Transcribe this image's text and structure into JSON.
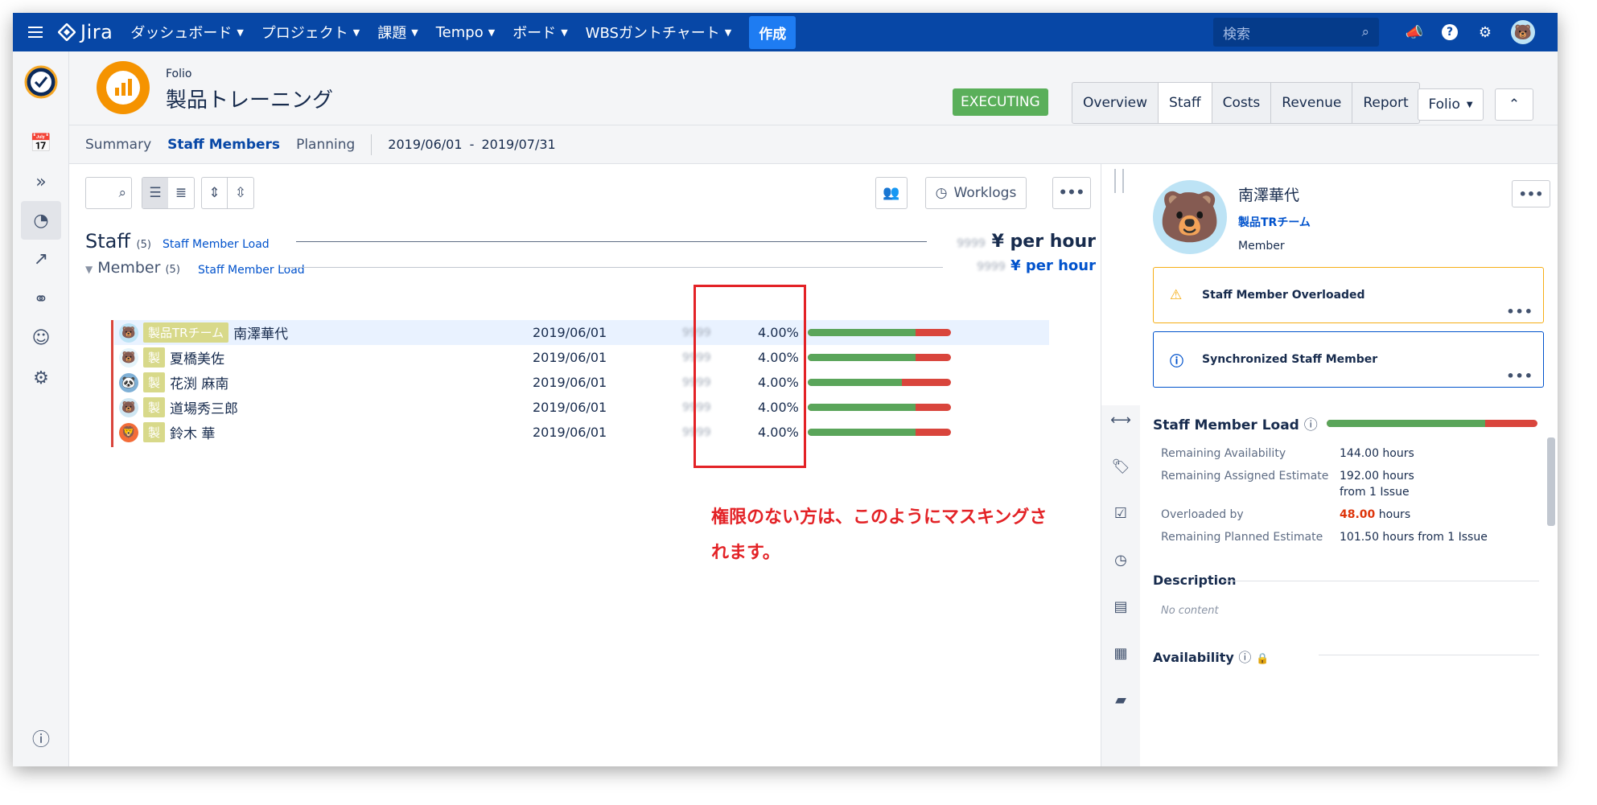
{
  "topnav": {
    "logo_text": "Jira",
    "items": [
      "ダッシュボード",
      "プロジェクト",
      "課題",
      "Tempo",
      "ボード",
      "WBSガントチャート"
    ],
    "create_label": "作成",
    "search_placeholder": "検索"
  },
  "header": {
    "kicker": "Folio",
    "title": "製品トレーニング",
    "status": "EXECUTING",
    "tabs": [
      "Overview",
      "Staff",
      "Costs",
      "Revenue",
      "Report"
    ],
    "folio_button": "Folio"
  },
  "subnav": {
    "items": [
      "Summary",
      "Staff Members",
      "Planning"
    ],
    "date_from": "2019/06/01",
    "date_sep": "-",
    "date_to": "2019/07/31"
  },
  "toolbar": {
    "worklogs_label": "Worklogs"
  },
  "staff": {
    "title": "Staff",
    "count": "(5)",
    "load_link": "Staff Member Load",
    "rate_mask": "9999",
    "rate_suffix": "¥ per hour"
  },
  "member": {
    "title": "Member",
    "count": "(5)",
    "load_link": "Staff Member Load",
    "rate_mask": "9999",
    "rate_suffix": "¥ per hour"
  },
  "rows": [
    {
      "team": "製品TRチーム",
      "name": "南澤華代",
      "date": "2019/06/01",
      "mask": "9999",
      "pct": "4.00%",
      "load": 0.75
    },
    {
      "team": "製",
      "name": "夏橋美佐",
      "date": "2019/06/01",
      "mask": "9999",
      "pct": "4.00%",
      "load": 0.75
    },
    {
      "team": "製",
      "name": "花渕 麻南",
      "date": "2019/06/01",
      "mask": "9999",
      "pct": "4.00%",
      "load": 0.66
    },
    {
      "team": "製",
      "name": "道場秀三郎",
      "date": "2019/06/01",
      "mask": "9999",
      "pct": "4.00%",
      "load": 0.75
    },
    {
      "team": "製",
      "name": "鈴木 華",
      "date": "2019/06/01",
      "mask": "9999",
      "pct": "4.00%",
      "load": 0.75
    }
  ],
  "callout": {
    "line1": "権限のない方は、このようにマスキングさ",
    "line2": "れます。"
  },
  "detail": {
    "name": "南澤華代",
    "team": "製品TRチーム",
    "role": "Member",
    "alert_overloaded": "Staff Member Overloaded",
    "alert_synced": "Synchronized Staff Member",
    "load_title": "Staff Member Load",
    "load_fraction": 0.75,
    "remaining_availability_label": "Remaining Availability",
    "remaining_availability_value": "144.00 hours",
    "remaining_assigned_label": "Remaining Assigned Estimate",
    "remaining_assigned_value": "192.00 hours",
    "remaining_assigned_sub": "from 1 Issue",
    "overloaded_label": "Overloaded by",
    "overloaded_value": "48.00",
    "overloaded_unit": "hours",
    "planned_label": "Remaining Planned Estimate",
    "planned_value": "101.50 hours from 1 Issue",
    "description_title": "Description",
    "description_value": "No content",
    "availability_title": "Availability"
  },
  "colors": {
    "nav": "#0747a6",
    "accent": "#0052cc",
    "ok": "#5aa55a",
    "over": "#d9453c",
    "callout": "#e32226"
  }
}
